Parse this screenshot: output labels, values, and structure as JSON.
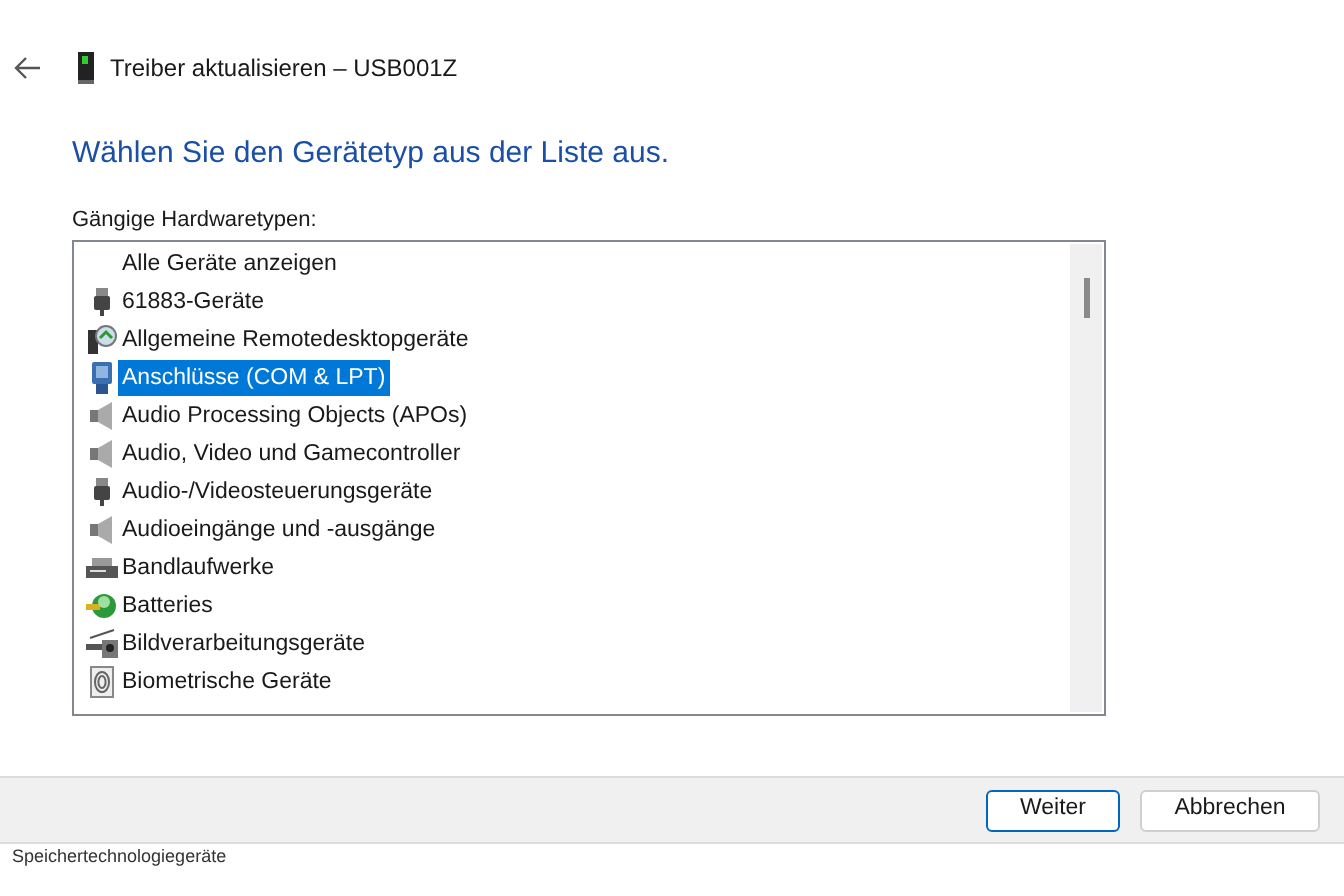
{
  "window": {
    "title": "Treiber aktualisieren – USB001Z"
  },
  "heading": "Wählen Sie den Gerätetyp aus der Liste aus.",
  "list": {
    "label": "Gängige Hardwaretypen:",
    "items": [
      {
        "label": "Alle Geräte anzeigen",
        "kind": "none",
        "selected": false
      },
      {
        "label": "61883-Geräte",
        "kind": "plug",
        "selected": false
      },
      {
        "label": "Allgemeine Remotedesktopgeräte",
        "kind": "remote",
        "selected": false
      },
      {
        "label": "Anschlüsse (COM & LPT)",
        "kind": "port",
        "selected": true
      },
      {
        "label": "Audio Processing Objects (APOs)",
        "kind": "speaker",
        "selected": false
      },
      {
        "label": "Audio, Video und Gamecontroller",
        "kind": "speaker",
        "selected": false
      },
      {
        "label": "Audio-/Videosteuerungsgeräte",
        "kind": "plug",
        "selected": false
      },
      {
        "label": "Audioeingänge und -ausgänge",
        "kind": "speaker",
        "selected": false
      },
      {
        "label": "Bandlaufwerke",
        "kind": "tape",
        "selected": false
      },
      {
        "label": "Batteries",
        "kind": "battery",
        "selected": false
      },
      {
        "label": "Bildverarbeitungsgeräte",
        "kind": "camera",
        "selected": false
      },
      {
        "label": "Biometrische Geräte",
        "kind": "fingerprint",
        "selected": false
      }
    ]
  },
  "buttons": [
    {
      "label": "Weiter",
      "kind": "primary"
    },
    {
      "label": "Abbrechen",
      "kind": "secondary"
    }
  ],
  "behind_text": "Speichertechnologiegeräte"
}
